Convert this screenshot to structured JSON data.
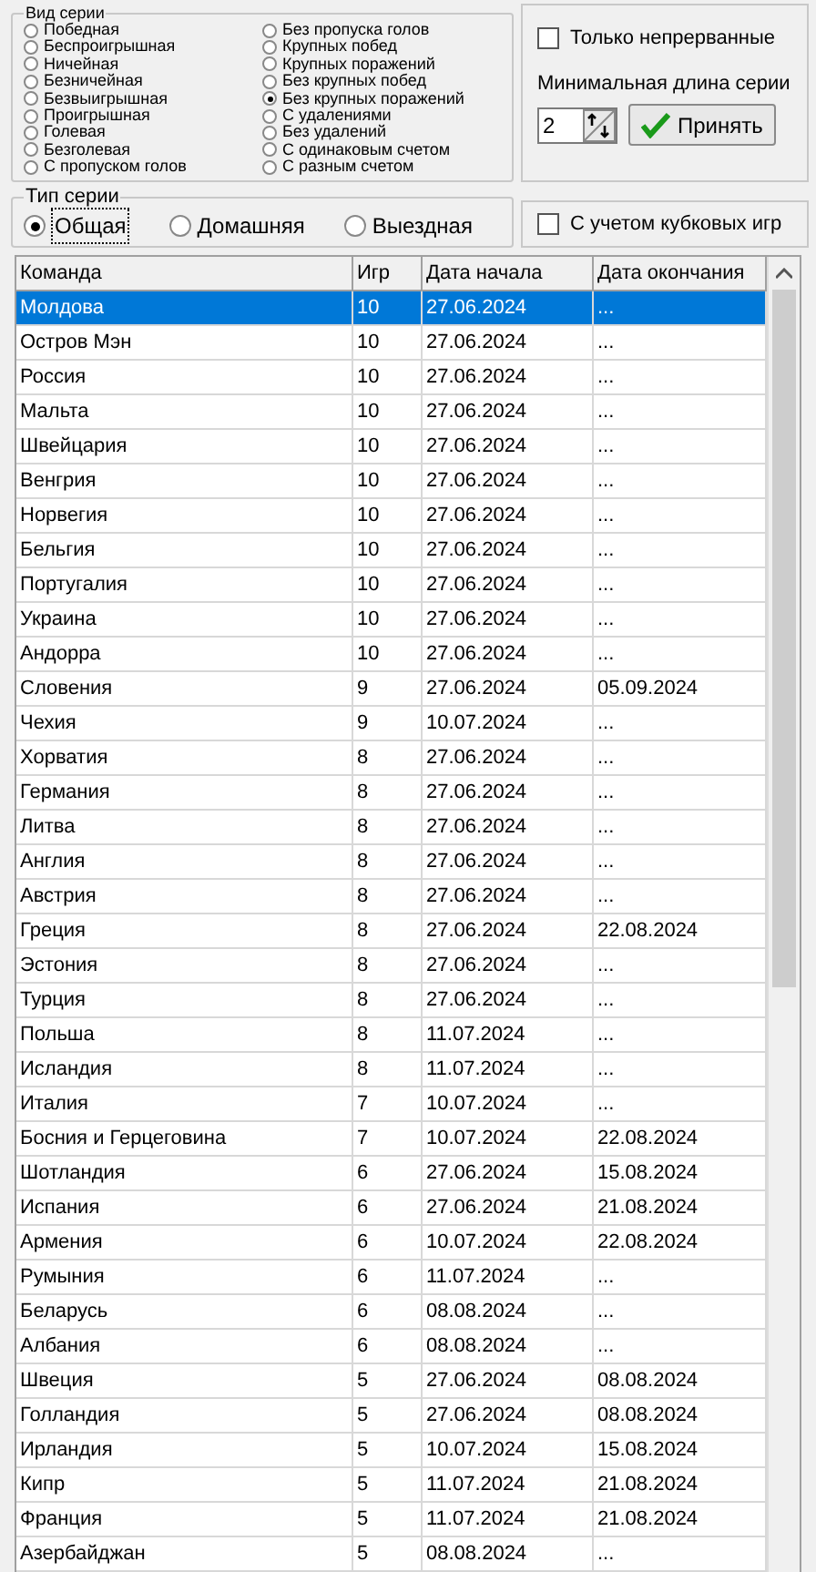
{
  "series_kind": {
    "title": "Вид серии",
    "options": [
      {
        "label": "Победная",
        "selected": false
      },
      {
        "label": "Беспроигрышная",
        "selected": false
      },
      {
        "label": "Ничейная",
        "selected": false
      },
      {
        "label": "Безничейная",
        "selected": false
      },
      {
        "label": "Безвыигрышная",
        "selected": false
      },
      {
        "label": "Проигрышная",
        "selected": false
      },
      {
        "label": "Голевая",
        "selected": false
      },
      {
        "label": "Безголевая",
        "selected": false
      },
      {
        "label": "С пропуском голов",
        "selected": false
      },
      {
        "label": "Без пропуска голов",
        "selected": false
      },
      {
        "label": "Крупных побед",
        "selected": false
      },
      {
        "label": "Крупных поражений",
        "selected": false
      },
      {
        "label": "Без крупных побед",
        "selected": false
      },
      {
        "label": "Без крупных поражений",
        "selected": true
      },
      {
        "label": "С удалениями",
        "selected": false
      },
      {
        "label": "Без удалений",
        "selected": false
      },
      {
        "label": "С одинаковым счетом",
        "selected": false
      },
      {
        "label": "С разным счетом",
        "selected": false
      }
    ]
  },
  "only_continuous": {
    "label": "Только непрерванные",
    "checked": false
  },
  "min_length": {
    "label": "Минимальная длина серии",
    "value": "2"
  },
  "apply_button": "Принять",
  "series_type": {
    "title": "Тип серии",
    "options": [
      {
        "label": "Общая",
        "selected": true
      },
      {
        "label": "Домашняя",
        "selected": false
      },
      {
        "label": "Выездная",
        "selected": false
      }
    ]
  },
  "include_cups": {
    "label": "С учетом кубковых игр",
    "checked": false
  },
  "table": {
    "columns": [
      "Команда",
      "Игр",
      "Дата начала",
      "Дата окончания"
    ],
    "rows": [
      {
        "cells": [
          "Молдова",
          "10",
          "27.06.2024",
          "..."
        ],
        "selected": true
      },
      {
        "cells": [
          "Остров Мэн",
          "10",
          "27.06.2024",
          "..."
        ],
        "selected": false
      },
      {
        "cells": [
          "Россия",
          "10",
          "27.06.2024",
          "..."
        ],
        "selected": false
      },
      {
        "cells": [
          "Мальта",
          "10",
          "27.06.2024",
          "..."
        ],
        "selected": false
      },
      {
        "cells": [
          "Швейцария",
          "10",
          "27.06.2024",
          "..."
        ],
        "selected": false
      },
      {
        "cells": [
          "Венгрия",
          "10",
          "27.06.2024",
          "..."
        ],
        "selected": false
      },
      {
        "cells": [
          "Норвегия",
          "10",
          "27.06.2024",
          "..."
        ],
        "selected": false
      },
      {
        "cells": [
          "Бельгия",
          "10",
          "27.06.2024",
          "..."
        ],
        "selected": false
      },
      {
        "cells": [
          "Португалия",
          "10",
          "27.06.2024",
          "..."
        ],
        "selected": false
      },
      {
        "cells": [
          "Украина",
          "10",
          "27.06.2024",
          "..."
        ],
        "selected": false
      },
      {
        "cells": [
          "Андорра",
          "10",
          "27.06.2024",
          "..."
        ],
        "selected": false
      },
      {
        "cells": [
          "Словения",
          "9",
          "27.06.2024",
          "05.09.2024"
        ],
        "selected": false
      },
      {
        "cells": [
          "Чехия",
          "9",
          "10.07.2024",
          "..."
        ],
        "selected": false
      },
      {
        "cells": [
          "Хорватия",
          "8",
          "27.06.2024",
          "..."
        ],
        "selected": false
      },
      {
        "cells": [
          "Германия",
          "8",
          "27.06.2024",
          "..."
        ],
        "selected": false
      },
      {
        "cells": [
          "Литва",
          "8",
          "27.06.2024",
          "..."
        ],
        "selected": false
      },
      {
        "cells": [
          "Англия",
          "8",
          "27.06.2024",
          "..."
        ],
        "selected": false
      },
      {
        "cells": [
          "Австрия",
          "8",
          "27.06.2024",
          "..."
        ],
        "selected": false
      },
      {
        "cells": [
          "Греция",
          "8",
          "27.06.2024",
          "22.08.2024"
        ],
        "selected": false
      },
      {
        "cells": [
          "Эстония",
          "8",
          "27.06.2024",
          "..."
        ],
        "selected": false
      },
      {
        "cells": [
          "Турция",
          "8",
          "27.06.2024",
          "..."
        ],
        "selected": false
      },
      {
        "cells": [
          "Польша",
          "8",
          "11.07.2024",
          "..."
        ],
        "selected": false
      },
      {
        "cells": [
          "Исландия",
          "8",
          "11.07.2024",
          "..."
        ],
        "selected": false
      },
      {
        "cells": [
          "Италия",
          "7",
          "10.07.2024",
          "..."
        ],
        "selected": false
      },
      {
        "cells": [
          "Босния и Герцеговина",
          "7",
          "10.07.2024",
          "22.08.2024"
        ],
        "selected": false
      },
      {
        "cells": [
          "Шотландия",
          "6",
          "27.06.2024",
          "15.08.2024"
        ],
        "selected": false
      },
      {
        "cells": [
          "Испания",
          "6",
          "27.06.2024",
          "21.08.2024"
        ],
        "selected": false
      },
      {
        "cells": [
          "Армения",
          "6",
          "10.07.2024",
          "22.08.2024"
        ],
        "selected": false
      },
      {
        "cells": [
          "Румыния",
          "6",
          "11.07.2024",
          "..."
        ],
        "selected": false
      },
      {
        "cells": [
          "Беларусь",
          "6",
          "08.08.2024",
          "..."
        ],
        "selected": false
      },
      {
        "cells": [
          "Албания",
          "6",
          "08.08.2024",
          "..."
        ],
        "selected": false
      },
      {
        "cells": [
          "Швеция",
          "5",
          "27.06.2024",
          "08.08.2024"
        ],
        "selected": false
      },
      {
        "cells": [
          "Голландия",
          "5",
          "27.06.2024",
          "08.08.2024"
        ],
        "selected": false
      },
      {
        "cells": [
          "Ирландия",
          "5",
          "10.07.2024",
          "15.08.2024"
        ],
        "selected": false
      },
      {
        "cells": [
          "Кипр",
          "5",
          "11.07.2024",
          "21.08.2024"
        ],
        "selected": false
      },
      {
        "cells": [
          "Франция",
          "5",
          "11.07.2024",
          "21.08.2024"
        ],
        "selected": false
      },
      {
        "cells": [
          "Азербайджан",
          "5",
          "08.08.2024",
          "..."
        ],
        "selected": false
      }
    ]
  }
}
